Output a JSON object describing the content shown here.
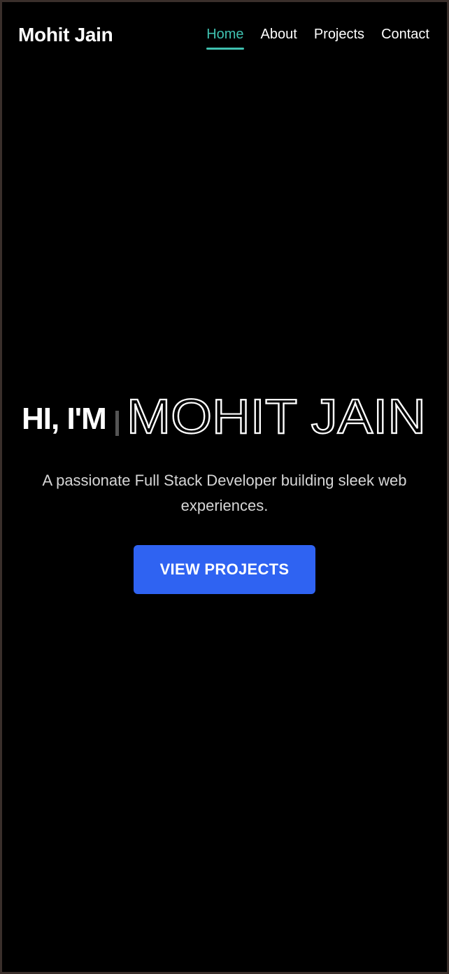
{
  "nav": {
    "brand": "Mohit Jain",
    "links": [
      {
        "label": "Home",
        "active": true
      },
      {
        "label": "About",
        "active": false
      },
      {
        "label": "Projects",
        "active": false
      },
      {
        "label": "Contact",
        "active": false
      }
    ]
  },
  "hero": {
    "greeting": "HI, I'M",
    "name": "MOHIT JAIN",
    "subtitle": "A passionate Full Stack Developer building sleek web experiences.",
    "cta_label": "VIEW PROJECTS"
  },
  "colors": {
    "background": "#000000",
    "accent": "#3fc1b0",
    "button": "#2f63f2",
    "frame": "#3a2f2b"
  }
}
